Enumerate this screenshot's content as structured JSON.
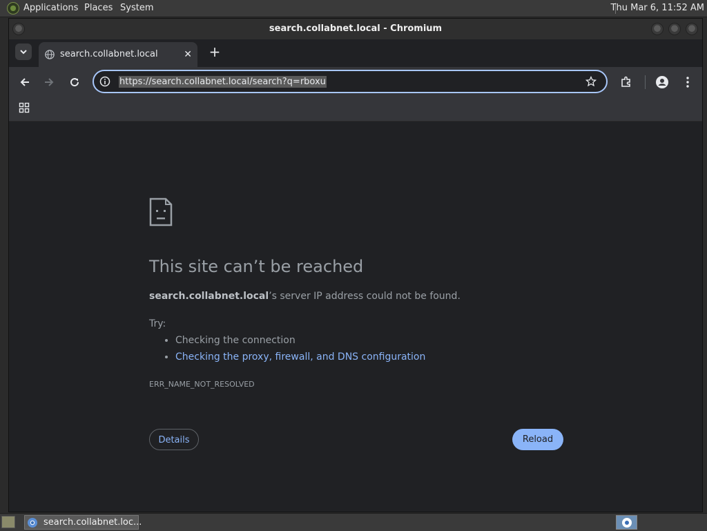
{
  "desktop": {
    "menus": [
      "Applications",
      "Places",
      "System"
    ],
    "clock": "Thu Mar  6, 11:52 AM"
  },
  "window": {
    "title": "search.collabnet.local - Chromium"
  },
  "browser": {
    "tab": {
      "title": "search.collabnet.local",
      "close": "✕"
    },
    "new_tab": "+",
    "url": "https://search.collabnet.local/search?q=rboxu"
  },
  "error_page": {
    "title": "This site can’t be reached",
    "host": "search.collabnet.local",
    "description_rest": "’s server IP address could not be found.",
    "try_label": "Try:",
    "suggestions": [
      {
        "text": "Checking the connection",
        "link": false
      },
      {
        "text": "Checking the proxy, firewall, and DNS configuration",
        "link": true
      }
    ],
    "error_code": "ERR_NAME_NOT_RESOLVED",
    "details_button": "Details",
    "reload_button": "Reload"
  },
  "taskbar": {
    "task_label": "search.collabnet.loc..."
  },
  "colors": {
    "accent": "#8ab4f8",
    "omnibox_border": "#a8c7fa",
    "page_bg": "#202124"
  }
}
